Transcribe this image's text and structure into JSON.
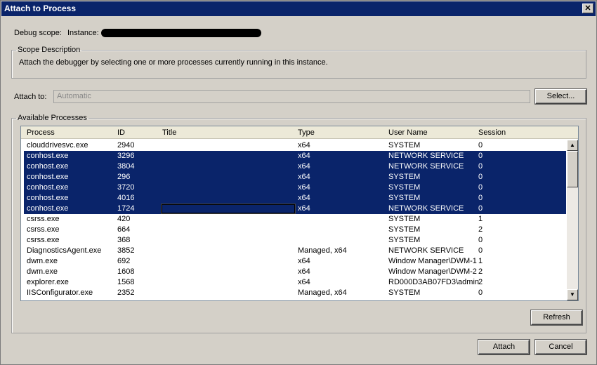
{
  "window": {
    "title": "Attach to Process",
    "close_glyph": "✕"
  },
  "debug_scope": {
    "label": "Debug scope:",
    "instance_label": "Instance:"
  },
  "scope_description": {
    "legend": "Scope Description",
    "text": "Attach the debugger by selecting one or more processes currently running in this instance."
  },
  "attach_to": {
    "label": "Attach to:",
    "value": "Automatic",
    "select_button": "Select..."
  },
  "available_processes": {
    "legend": "Available Processes",
    "columns": [
      "Process",
      "ID",
      "Title",
      "Type",
      "User Name",
      "Session"
    ],
    "rows": [
      {
        "process": "clouddrivesvc.exe",
        "id": "2940",
        "title": "",
        "type": "x64",
        "user": "SYSTEM",
        "session": "0",
        "selected": false
      },
      {
        "process": "conhost.exe",
        "id": "3296",
        "title": "",
        "type": "x64",
        "user": "NETWORK SERVICE",
        "session": "0",
        "selected": true
      },
      {
        "process": "conhost.exe",
        "id": "3804",
        "title": "",
        "type": "x64",
        "user": "NETWORK SERVICE",
        "session": "0",
        "selected": true
      },
      {
        "process": "conhost.exe",
        "id": "296",
        "title": "",
        "type": "x64",
        "user": "SYSTEM",
        "session": "0",
        "selected": true
      },
      {
        "process": "conhost.exe",
        "id": "3720",
        "title": "",
        "type": "x64",
        "user": "SYSTEM",
        "session": "0",
        "selected": true
      },
      {
        "process": "conhost.exe",
        "id": "4016",
        "title": "",
        "type": "x64",
        "user": "SYSTEM",
        "session": "0",
        "selected": true
      },
      {
        "process": "conhost.exe",
        "id": "1724",
        "title": "",
        "type": "x64",
        "user": "NETWORK SERVICE",
        "session": "0",
        "selected": true,
        "focused": true
      },
      {
        "process": "csrss.exe",
        "id": "420",
        "title": "",
        "type": "",
        "user": "SYSTEM",
        "session": "1",
        "selected": false
      },
      {
        "process": "csrss.exe",
        "id": "664",
        "title": "",
        "type": "",
        "user": "SYSTEM",
        "session": "2",
        "selected": false
      },
      {
        "process": "csrss.exe",
        "id": "368",
        "title": "",
        "type": "",
        "user": "SYSTEM",
        "session": "0",
        "selected": false
      },
      {
        "process": "DiagnosticsAgent.exe",
        "id": "3852",
        "title": "",
        "type": "Managed, x64",
        "user": "NETWORK SERVICE",
        "session": "0",
        "selected": false
      },
      {
        "process": "dwm.exe",
        "id": "692",
        "title": "",
        "type": "x64",
        "user": "Window Manager\\DWM-1",
        "session": "1",
        "selected": false
      },
      {
        "process": "dwm.exe",
        "id": "1608",
        "title": "",
        "type": "x64",
        "user": "Window Manager\\DWM-2",
        "session": "2",
        "selected": false
      },
      {
        "process": "explorer.exe",
        "id": "1568",
        "title": "",
        "type": "x64",
        "user": "RD000D3AB07FD3\\admin",
        "session": "2",
        "selected": false
      },
      {
        "process": "IISConfigurator.exe",
        "id": "2352",
        "title": "",
        "type": "Managed, x64",
        "user": "SYSTEM",
        "session": "0",
        "selected": false
      }
    ],
    "refresh_button": "Refresh"
  },
  "footer": {
    "attach_button": "Attach",
    "cancel_button": "Cancel"
  },
  "scroll": {
    "up_glyph": "▲",
    "down_glyph": "▼"
  },
  "colors": {
    "selection": "#0a246a",
    "titlebar": "#0a246a",
    "face": "#d4d0c8"
  }
}
